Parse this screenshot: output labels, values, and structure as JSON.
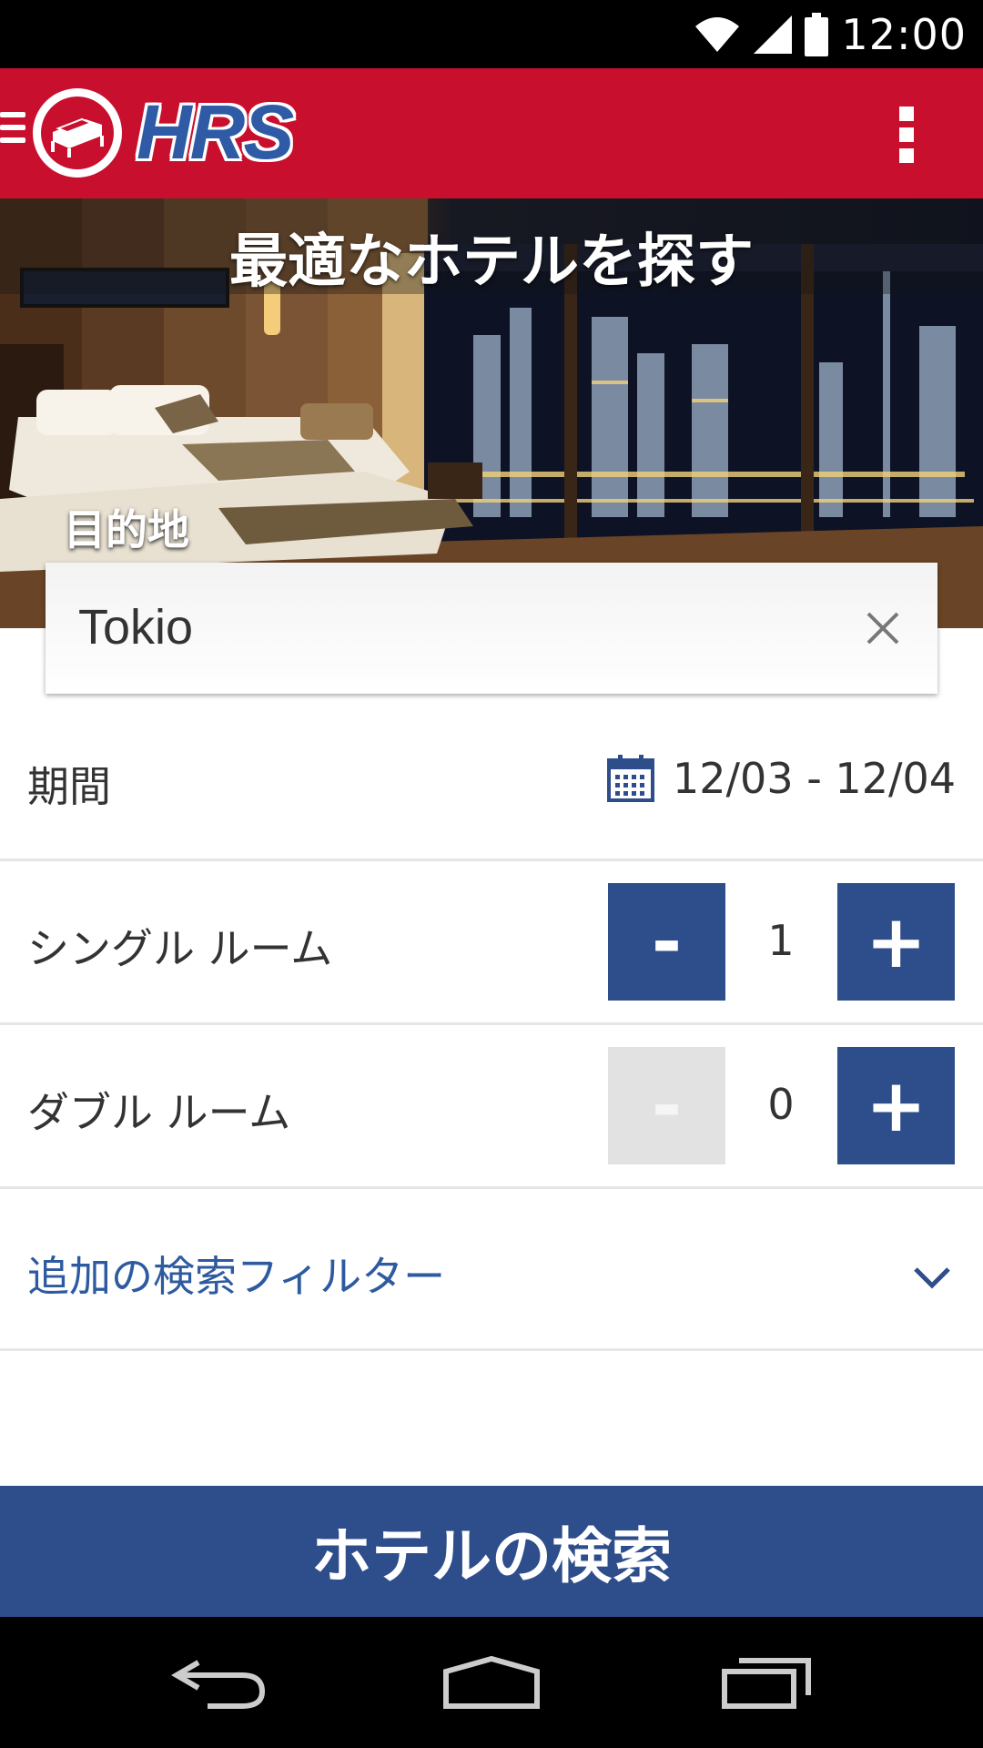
{
  "status_bar": {
    "time": "12:00",
    "icons": [
      "wifi-icon",
      "signal-icon",
      "battery-icon"
    ]
  },
  "app_bar": {
    "logo_text": "HRS",
    "brand_color": "#c8102e",
    "logo_color": "#2f5aa5",
    "icons": [
      "menu-icon",
      "bed-logo-icon",
      "overflow-menu-icon"
    ]
  },
  "hero": {
    "title": "最適なホテルを探す",
    "destination_label": "目的地"
  },
  "destination": {
    "value": "Tokio"
  },
  "period": {
    "label": "期間",
    "dates": "12/03 - 12/04",
    "icon": "calendar-icon"
  },
  "single_room": {
    "label": "シングル ルーム",
    "minus": "-",
    "count": "1",
    "plus": "+"
  },
  "double_room": {
    "label": "ダブル ルーム",
    "minus": "-",
    "count": "0",
    "plus": "+"
  },
  "filters": {
    "label": "追加の検索フィルター",
    "icon": "chevron-down-icon"
  },
  "search_button": {
    "label": "ホテルの検索",
    "color": "#2e4d8b"
  },
  "nav_bar": {
    "icons": [
      "back-icon",
      "home-icon",
      "recents-icon"
    ]
  }
}
